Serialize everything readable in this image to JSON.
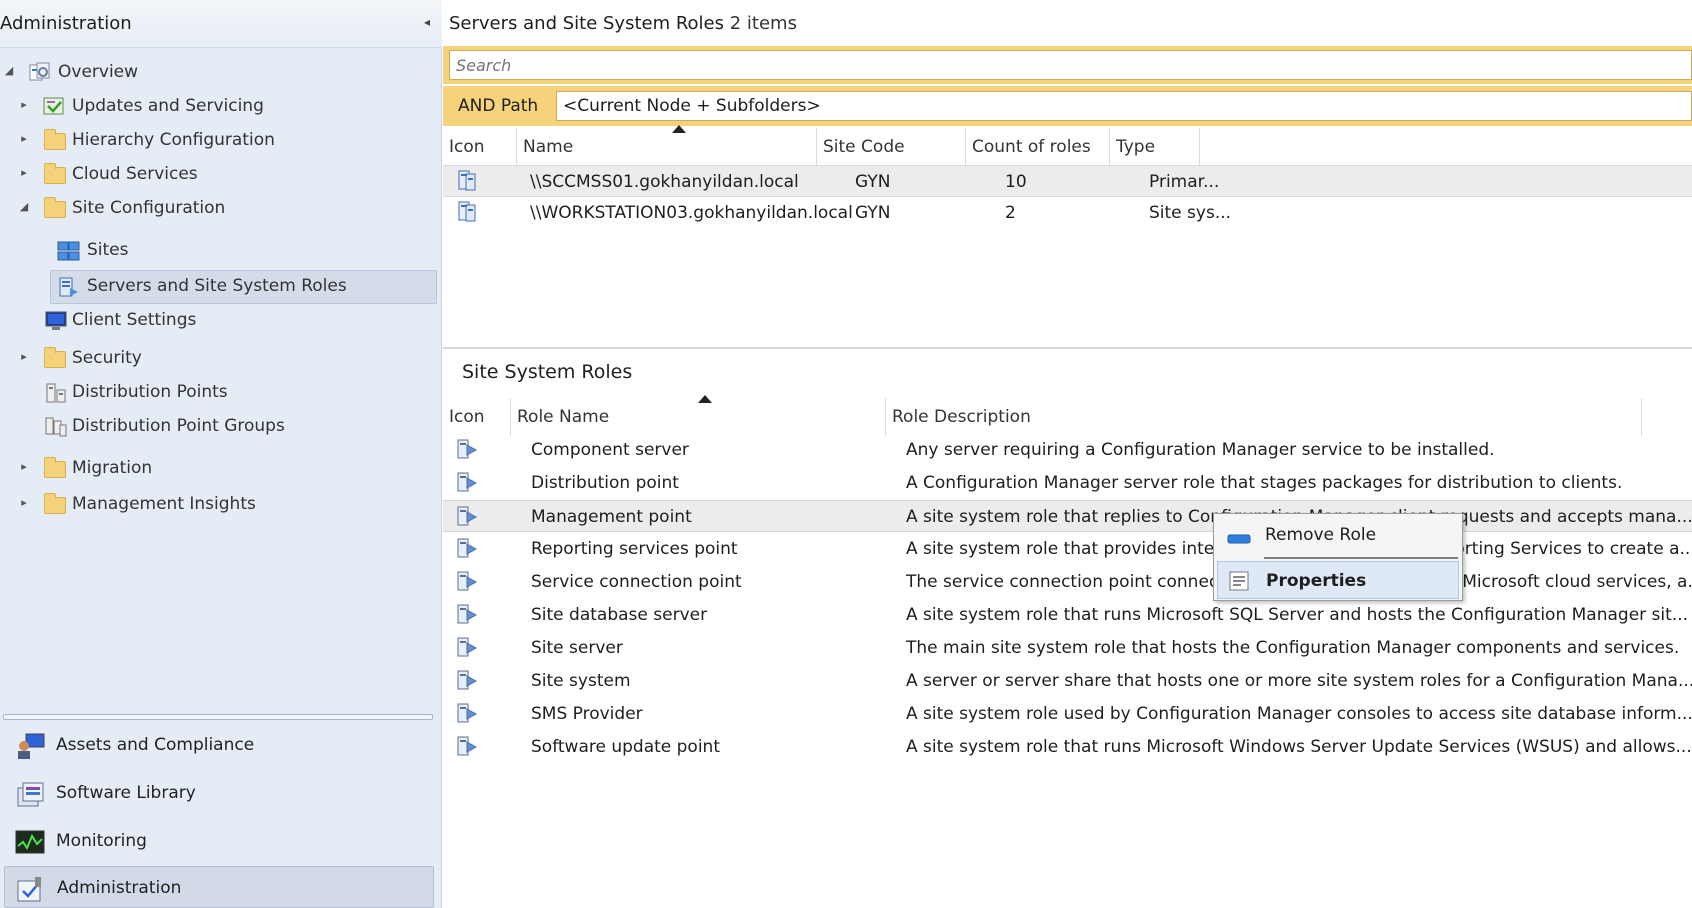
{
  "nav": {
    "title": "Administration",
    "collapse_glyph": "◂",
    "tree": [
      {
        "label": "Overview",
        "expander": "◢",
        "icon": "overview-icon"
      },
      {
        "label": "Updates and Servicing",
        "expander": "▸",
        "icon": "updates-icon"
      },
      {
        "label": "Hierarchy Configuration",
        "expander": "▸",
        "icon": "folder-icon"
      },
      {
        "label": "Cloud Services",
        "expander": "▸",
        "icon": "folder-icon"
      },
      {
        "label": "Site Configuration",
        "expander": "◢",
        "icon": "folder-icon"
      },
      {
        "label": "Sites",
        "expander": "",
        "icon": "sites-icon"
      },
      {
        "label": "Servers and Site System Roles",
        "expander": "",
        "icon": "servers-icon"
      },
      {
        "label": "Client Settings",
        "expander": "",
        "icon": "client-settings-icon"
      },
      {
        "label": "Security",
        "expander": "▸",
        "icon": "folder-icon"
      },
      {
        "label": "Distribution Points",
        "expander": "",
        "icon": "distribution-points-icon"
      },
      {
        "label": "Distribution Point Groups",
        "expander": "",
        "icon": "distribution-point-groups-icon"
      },
      {
        "label": "Migration",
        "expander": "▸",
        "icon": "folder-icon"
      },
      {
        "label": "Management Insights",
        "expander": "▸",
        "icon": "folder-icon"
      }
    ],
    "workspaces": [
      {
        "label": "Assets and Compliance",
        "icon": "assets-icon"
      },
      {
        "label": "Software Library",
        "icon": "software-library-icon"
      },
      {
        "label": "Monitoring",
        "icon": "monitoring-icon"
      },
      {
        "label": "Administration",
        "icon": "administration-icon"
      }
    ]
  },
  "main": {
    "title": "Servers and Site System Roles",
    "count": "2 items",
    "search_placeholder": "Search",
    "path_label": "AND Path",
    "path_value": "<Current Node + Subfolders>",
    "servers_columns": [
      "Icon",
      "Name",
      "Site Code",
      "Count of roles",
      "Type"
    ],
    "servers": [
      {
        "name": "\\\\SCCMSS01.gokhanyildan.local",
        "site_code": "GYN",
        "count": "10",
        "type": "Primar..."
      },
      {
        "name": "\\\\WORKSTATION03.gokhanyildan.local",
        "site_code": "GYN",
        "count": "2",
        "type": "Site sys..."
      }
    ],
    "detail_title": "Site System Roles",
    "roles_columns": [
      "Icon",
      "Role Name",
      "Role Description"
    ],
    "roles": [
      {
        "name": "Component server",
        "desc": "Any server requiring a Configuration Manager service to be installed."
      },
      {
        "name": "Distribution point",
        "desc": "A Configuration Manager server role that stages packages for distribution to clients."
      },
      {
        "name": "Management point",
        "desc": "A site system role that replies to Configuration Manager client requests and accepts mana..."
      },
      {
        "name": "Reporting services point",
        "desc": "A site system role that  provides integration with SQL Server Reporting Services to create a..."
      },
      {
        "name": "Service connection point",
        "desc": "The service connection point connects Configuration Manager to Microsoft cloud services, a..."
      },
      {
        "name": "Site database server",
        "desc": "A site system role that runs Microsoft SQL Server and hosts the Configuration Manager sit..."
      },
      {
        "name": "Site server",
        "desc": "The main site system role that hosts the Configuration Manager components and services."
      },
      {
        "name": "Site system",
        "desc": "A server or server share that hosts one or more site system roles for a Configuration Mana..."
      },
      {
        "name": "SMS Provider",
        "desc": "A site system role used by Configuration Manager consoles to access site database inform..."
      },
      {
        "name": "Software update point",
        "desc": "A site system role that runs Microsoft Windows Server Update Services (WSUS) and allows..."
      }
    ]
  },
  "context_menu": {
    "items": [
      {
        "label": "Remove Role",
        "icon": "remove-icon"
      },
      {
        "label": "Properties",
        "icon": "properties-icon"
      }
    ]
  },
  "colors": {
    "nav_bg": "#e6ecf5",
    "search_accent": "#f6d37b",
    "selection": "#d4dcea"
  }
}
